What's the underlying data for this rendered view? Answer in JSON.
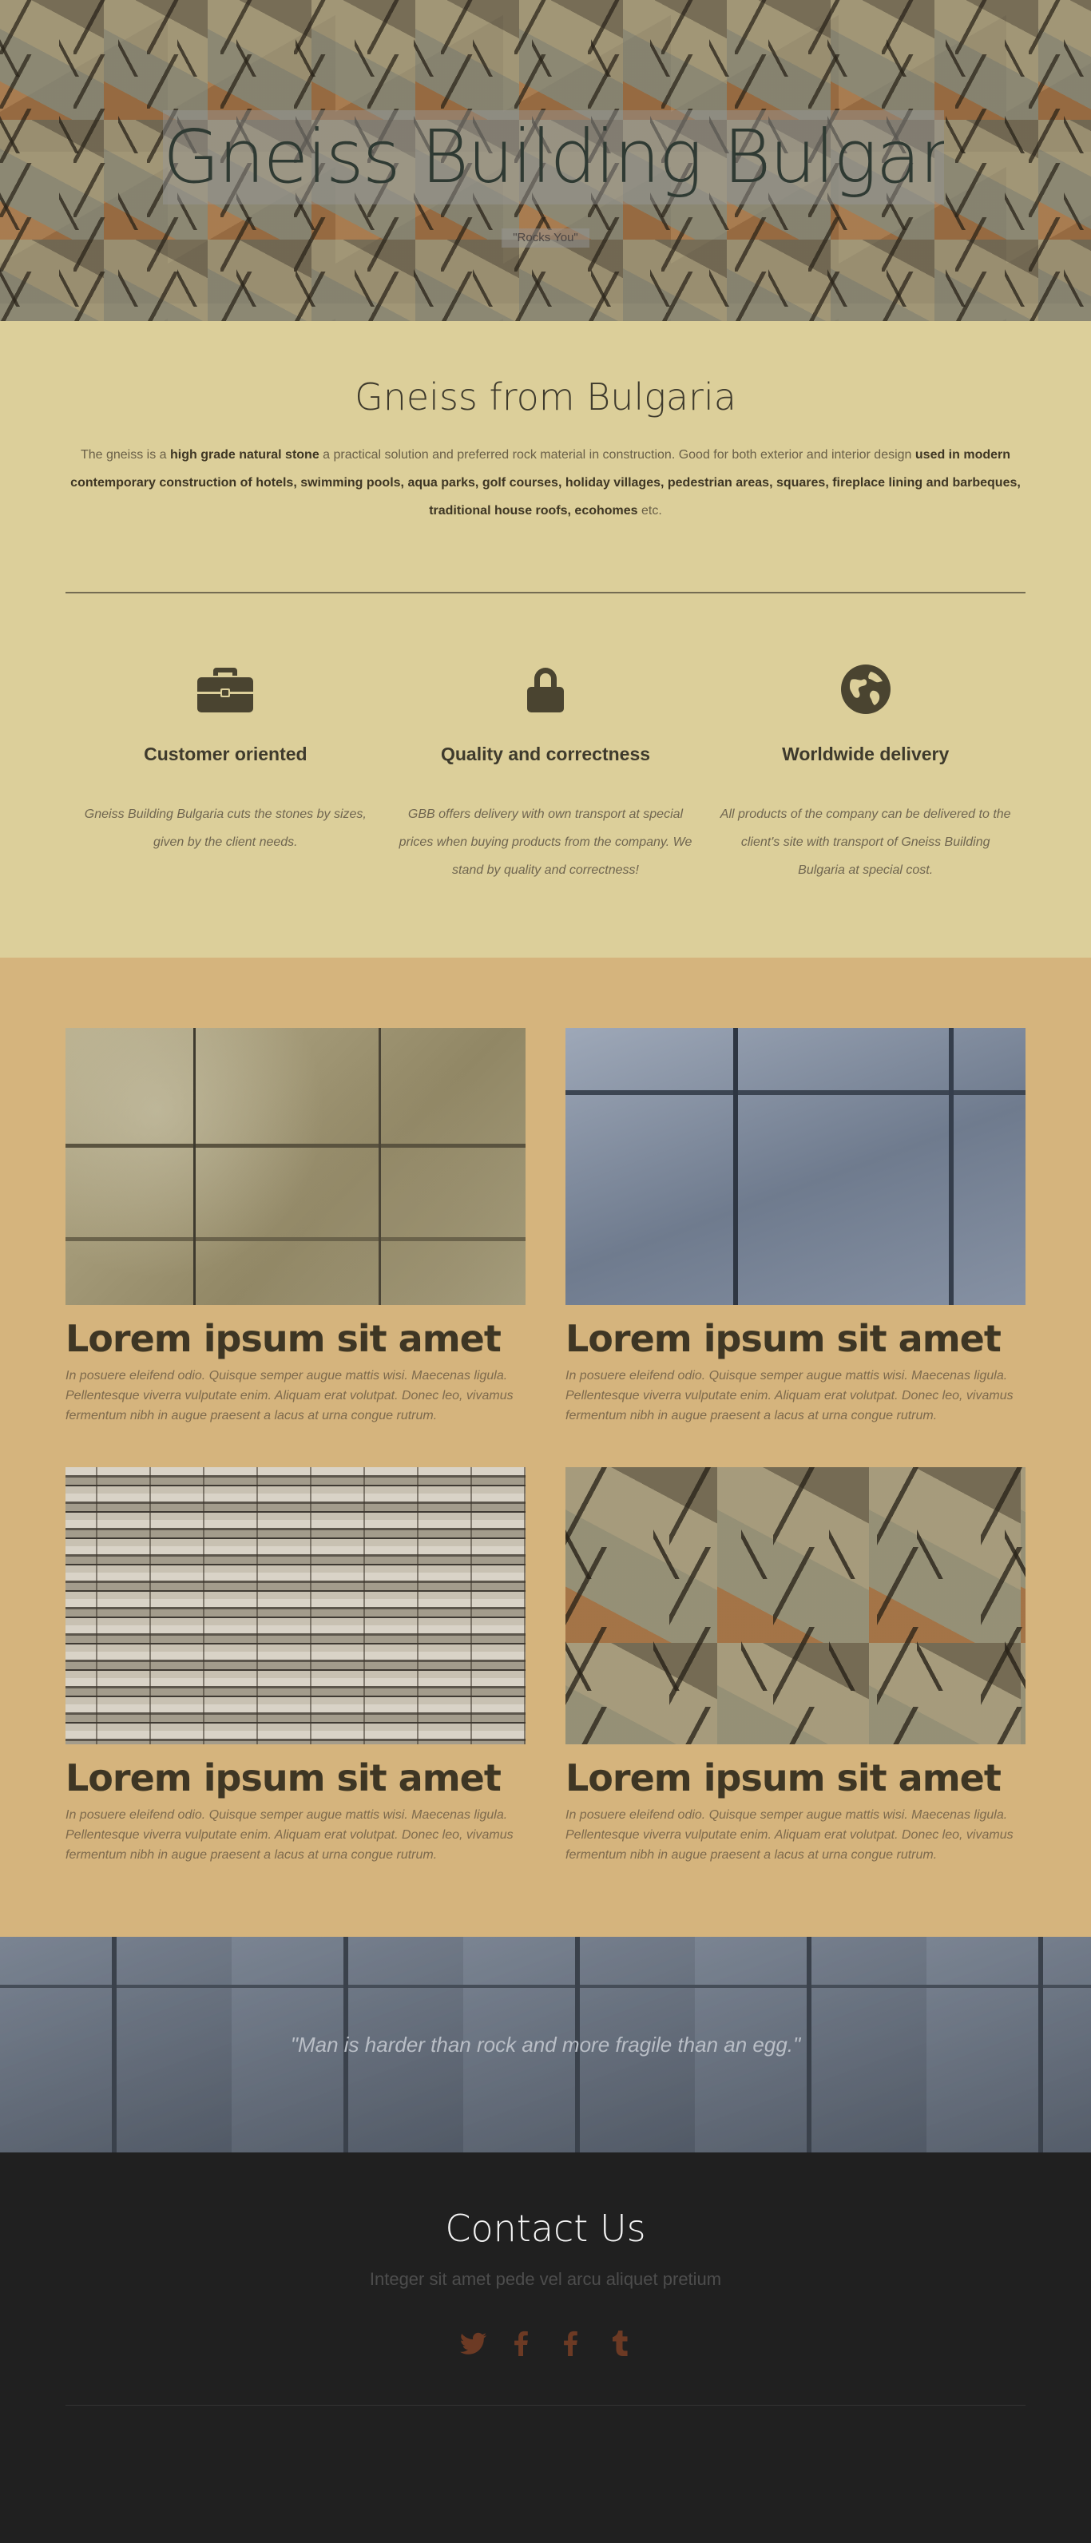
{
  "hero": {
    "title": "Gneiss Building Bulgaria",
    "subtitle": "\"Rocks You\""
  },
  "intro": {
    "title": "Gneiss from Bulgaria",
    "text": {
      "part1": "The gneiss is a ",
      "bold1": "high grade natural stone",
      "part2": " a practical solution and preferred rock material in construction. Good for both exterior and interior design ",
      "bold2": "used in modern contemporary construction of hotels, swimming pools, aqua parks, golf courses, holiday villages, pedestrian areas, squares, fireplace lining and barbeques, traditional house roofs, ecohomes",
      "part3": " etc."
    }
  },
  "features": [
    {
      "icon": "briefcase-icon",
      "title": "Customer oriented",
      "text": "Gneiss Building Bulgaria cuts the stones by sizes, given by the client needs."
    },
    {
      "icon": "lock-icon",
      "title": "Quality and correctness",
      "text": "GBB offers delivery with own transport at special prices when buying products from the company. We stand by quality and correctness!"
    },
    {
      "icon": "globe-icon",
      "title": "Worldwide delivery",
      "text": "All products of the company can be delivered to the client's site with transport of Gneiss Building Bulgaria at special cost."
    }
  ],
  "gallery": [
    {
      "title": "Lorem ipsum sit amet",
      "text": "In posuere eleifend odio. Quisque semper augue mattis wisi. Maecenas ligula. Pellentesque viverra vulputate enim. Aliquam erat volutpat. Donec leo, vivamus fermentum nibh in augue praesent a lacus at urna congue rutrum."
    },
    {
      "title": "Lorem ipsum sit amet",
      "text": "In posuere eleifend odio. Quisque semper augue mattis wisi. Maecenas ligula. Pellentesque viverra vulputate enim. Aliquam erat volutpat. Donec leo, vivamus fermentum nibh in augue praesent a lacus at urna congue rutrum."
    },
    {
      "title": "Lorem ipsum sit amet",
      "text": "In posuere eleifend odio. Quisque semper augue mattis wisi. Maecenas ligula. Pellentesque viverra vulputate enim. Aliquam erat volutpat. Donec leo, vivamus fermentum nibh in augue praesent a lacus at urna congue rutrum."
    },
    {
      "title": "Lorem ipsum sit amet",
      "text": "In posuere eleifend odio. Quisque semper augue mattis wisi. Maecenas ligula. Pellentesque viverra vulputate enim. Aliquam erat volutpat. Donec leo, vivamus fermentum nibh in augue praesent a lacus at urna congue rutrum."
    }
  ],
  "quote": {
    "text": "\"Man is harder than rock and more fragile than an egg.\""
  },
  "contact": {
    "title": "Contact Us",
    "subtitle": "Integer sit amet pede vel arcu aliquet pretium",
    "social": [
      {
        "icon": "twitter-icon",
        "glyph": "t"
      },
      {
        "icon": "facebook-icon",
        "glyph": "f"
      },
      {
        "icon": "facebook-icon",
        "glyph": "f"
      },
      {
        "icon": "tumblr-icon",
        "glyph": "t"
      }
    ]
  },
  "colors": {
    "intro_bg": "#dccf9a",
    "gallery_bg": "#d5b47d",
    "footer_bg": "#202020",
    "icon_color": "#4a4430",
    "social_color": "#6c3a24"
  }
}
